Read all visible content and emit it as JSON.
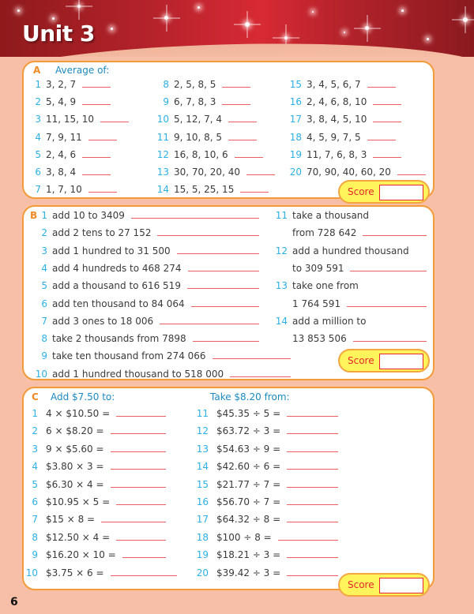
{
  "header": {
    "title": "Unit 3"
  },
  "colors": {
    "number": "#2bb0e4",
    "section_letter": "#f08a24",
    "heading": "#1c8ac0",
    "answer_line": "#ee5f63",
    "score_bg": "#fff45c",
    "score_text": "#e8262c",
    "page_bg": "#f8bfa8"
  },
  "sectionA": {
    "letter": "A",
    "heading": "Average of:",
    "questions": [
      {
        "n": "1",
        "text": "3, 2, 7"
      },
      {
        "n": "2",
        "text": "5, 4, 9"
      },
      {
        "n": "3",
        "text": "11, 15, 10"
      },
      {
        "n": "4",
        "text": "7, 9, 11"
      },
      {
        "n": "5",
        "text": "2, 4, 6"
      },
      {
        "n": "6",
        "text": "3, 8, 4"
      },
      {
        "n": "7",
        "text": "1, 7, 10"
      },
      {
        "n": "8",
        "text": "2, 5, 8, 5"
      },
      {
        "n": "9",
        "text": "6, 7, 8, 3"
      },
      {
        "n": "10",
        "text": "5, 12, 7, 4"
      },
      {
        "n": "11",
        "text": "9, 10, 8, 5"
      },
      {
        "n": "12",
        "text": "16, 8, 10, 6"
      },
      {
        "n": "13",
        "text": "30, 70, 20, 40"
      },
      {
        "n": "14",
        "text": "15, 5, 25, 15"
      },
      {
        "n": "15",
        "text": "3, 4, 5, 6, 7"
      },
      {
        "n": "16",
        "text": "2, 4, 6, 8, 10"
      },
      {
        "n": "17",
        "text": "3, 8, 4, 5, 10"
      },
      {
        "n": "18",
        "text": "4, 5, 9, 7, 5"
      },
      {
        "n": "19",
        "text": "11, 7, 6, 8, 3"
      },
      {
        "n": "20",
        "text": "70, 90, 40, 60, 20"
      }
    ],
    "score_label": "Score"
  },
  "sectionB": {
    "letter": "B",
    "questions": [
      {
        "n": "1",
        "text": "add 10 to 3409"
      },
      {
        "n": "2",
        "text": "add 2 tens to 27 152"
      },
      {
        "n": "3",
        "text": "add 1 hundred to 31 500"
      },
      {
        "n": "4",
        "text": "add 4 hundreds to 468 274"
      },
      {
        "n": "5",
        "text": "add a thousand to 616 519"
      },
      {
        "n": "6",
        "text": "add ten thousand to 84 064"
      },
      {
        "n": "7",
        "text": "add 3 ones to 18 006"
      },
      {
        "n": "8",
        "text": "take 2 thousands from 7898"
      },
      {
        "n": "9",
        "text": "take ten thousand from 274 066"
      },
      {
        "n": "10",
        "text": "add 1 hundred thousand to 518 000"
      },
      {
        "n": "11",
        "text": "take a thousand",
        "text2": "from 728 642"
      },
      {
        "n": "12",
        "text": "add a hundred thousand",
        "text2": "to 309 591"
      },
      {
        "n": "13",
        "text": "take one from",
        "text2": "1 764 591"
      },
      {
        "n": "14",
        "text": "add a million to",
        "text2": "13 853 506"
      }
    ],
    "score_label": "Score"
  },
  "sectionC": {
    "letter": "C",
    "heading_left": "Add $7.50 to:",
    "heading_right": "Take $8.20 from:",
    "questions": [
      {
        "n": "1",
        "text": "4 × $10.50 ="
      },
      {
        "n": "2",
        "text": "6 × $8.20 ="
      },
      {
        "n": "3",
        "text": "9 × $5.60 ="
      },
      {
        "n": "4",
        "text": "$3.80 × 3 ="
      },
      {
        "n": "5",
        "text": "$6.30 × 4 ="
      },
      {
        "n": "6",
        "text": "$10.95 × 5 ="
      },
      {
        "n": "7",
        "text": "$15 × 8 ="
      },
      {
        "n": "8",
        "text": "$12.50 × 4 ="
      },
      {
        "n": "9",
        "text": "$16.20 × 10 ="
      },
      {
        "n": "10",
        "text": "$3.75 × 6 ="
      },
      {
        "n": "11",
        "text": "$45.35 ÷ 5 ="
      },
      {
        "n": "12",
        "text": "$63.72 ÷ 3 ="
      },
      {
        "n": "13",
        "text": "$54.63 ÷ 9 ="
      },
      {
        "n": "14",
        "text": "$42.60 ÷ 6 ="
      },
      {
        "n": "15",
        "text": "$21.77 ÷ 7 ="
      },
      {
        "n": "16",
        "text": "$56.70 ÷ 7 ="
      },
      {
        "n": "17",
        "text": "$64.32 ÷ 8 ="
      },
      {
        "n": "18",
        "text": "$100 ÷ 8 ="
      },
      {
        "n": "19",
        "text": "$18.21 ÷ 3 ="
      },
      {
        "n": "20",
        "text": "$39.42 ÷ 3 ="
      }
    ],
    "score_label": "Score"
  },
  "page_number": "6"
}
